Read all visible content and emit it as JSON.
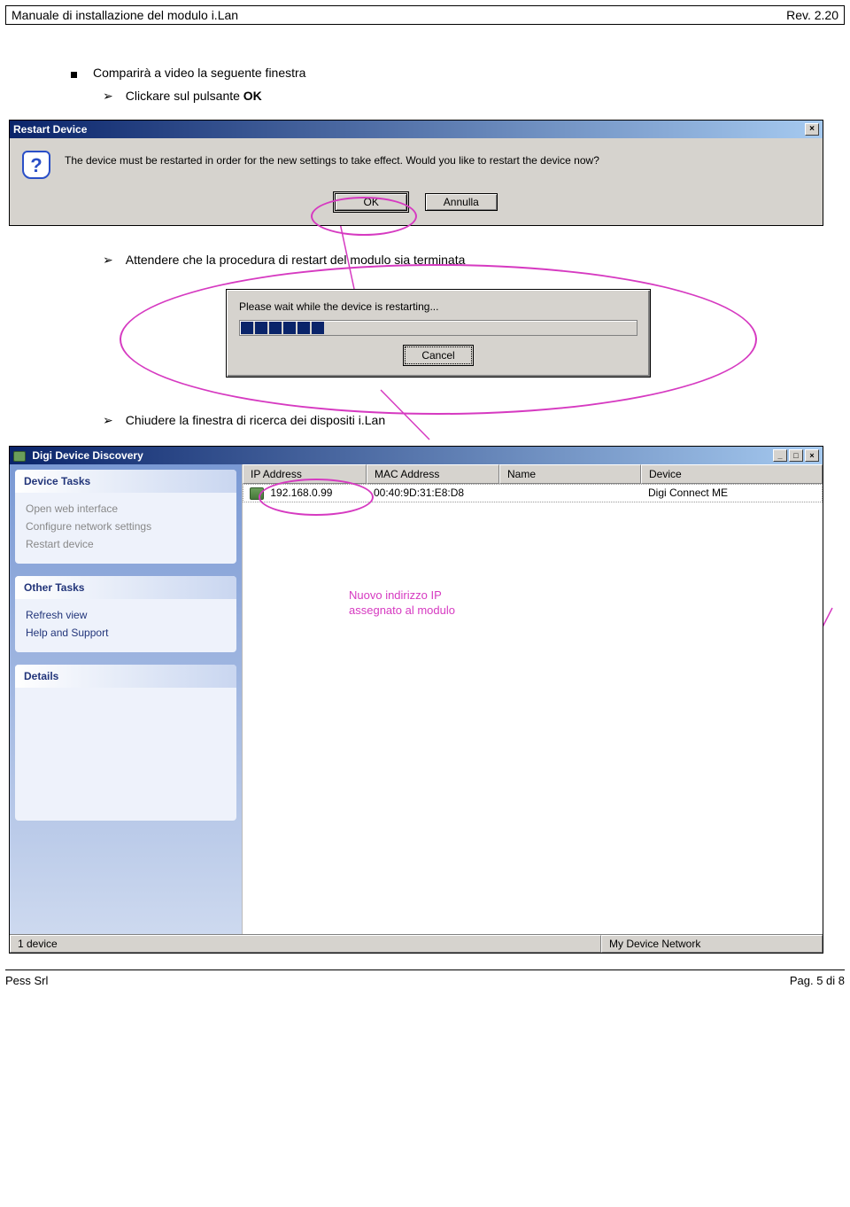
{
  "header": {
    "title": "Manuale di installazione del modulo i.Lan",
    "rev": "Rev. 2.20"
  },
  "text": {
    "b1": "Comparirà a video la seguente finestra",
    "a1_prefix": "Clickare sul pulsante ",
    "a1_bold": "OK",
    "a2": "Attendere che la procedura di restart del modulo sia terminata",
    "a3": "Chiudere la finestra di ricerca dei dispositi i.Lan"
  },
  "dlg_restart": {
    "title": "Restart Device",
    "message": "The device must be restarted in order for the new settings to take effect. Would you like to restart the device now?",
    "ok": "OK",
    "cancel": "Annulla",
    "close": "×"
  },
  "dlg_progress": {
    "message": "Please wait while the device is restarting...",
    "cancel": "Cancel"
  },
  "discovery": {
    "title": "Digi Device Discovery",
    "min": "_",
    "max": "□",
    "close": "×",
    "side": {
      "device_tasks": "Device Tasks",
      "open_web": "Open web interface",
      "configure": "Configure network settings",
      "restart": "Restart device",
      "other_tasks": "Other Tasks",
      "refresh": "Refresh view",
      "help": "Help and Support",
      "details": "Details"
    },
    "columns": {
      "ip": "IP Address",
      "mac": "MAC Address",
      "name": "Name",
      "device": "Device"
    },
    "row": {
      "ip": "192.168.0.99",
      "mac": "00:40:9D:31:E8:D8",
      "name": "",
      "device": "Digi Connect ME"
    },
    "status": {
      "left": "1 device",
      "right": "My Device Network"
    }
  },
  "annotation": {
    "ip_note_l1": "Nuovo indirizzo IP",
    "ip_note_l2": "assegnato al modulo"
  },
  "footer": {
    "left": "Pess Srl",
    "right": "Pag. 5 di 8"
  }
}
